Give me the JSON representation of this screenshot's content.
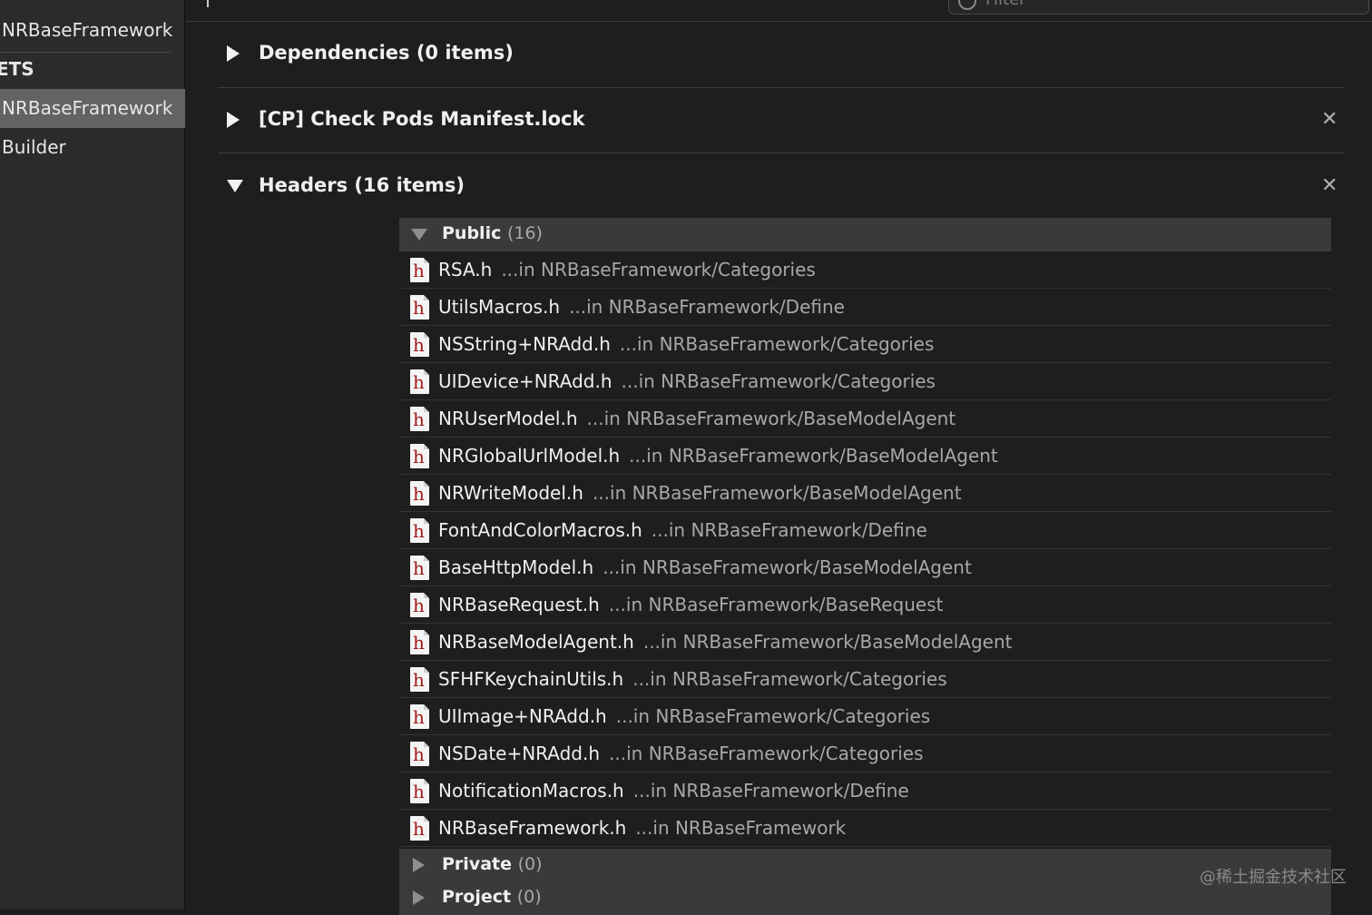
{
  "sidebar": {
    "items": [
      {
        "label": "NRBaseFramework",
        "selected": false
      },
      {
        "label": "ETS",
        "selected": false
      },
      {
        "label": "NRBaseFramework",
        "selected": true
      },
      {
        "label": "Builder",
        "selected": false
      }
    ]
  },
  "filter": {
    "placeholder": "Filter"
  },
  "phases": [
    {
      "title": "Dependencies (0 items)",
      "expanded": false,
      "closable": false
    },
    {
      "title": "[CP] Check Pods Manifest.lock",
      "expanded": false,
      "closable": true,
      "close_glyph": "✕"
    },
    {
      "title": "Headers (16 items)",
      "expanded": true,
      "closable": true,
      "close_glyph": "✕"
    }
  ],
  "headers": {
    "public": {
      "label": "Public",
      "count": "(16)"
    },
    "files": [
      {
        "name": "RSA.h",
        "path": "...in NRBaseFramework/Categories"
      },
      {
        "name": "UtilsMacros.h",
        "path": "...in NRBaseFramework/Define"
      },
      {
        "name": "NSString+NRAdd.h",
        "path": "...in NRBaseFramework/Categories"
      },
      {
        "name": "UIDevice+NRAdd.h",
        "path": "...in NRBaseFramework/Categories"
      },
      {
        "name": "NRUserModel.h",
        "path": "...in NRBaseFramework/BaseModelAgent"
      },
      {
        "name": "NRGlobalUrlModel.h",
        "path": "...in NRBaseFramework/BaseModelAgent"
      },
      {
        "name": "NRWriteModel.h",
        "path": "...in NRBaseFramework/BaseModelAgent"
      },
      {
        "name": "FontAndColorMacros.h",
        "path": "...in NRBaseFramework/Define"
      },
      {
        "name": "BaseHttpModel.h",
        "path": "...in NRBaseFramework/BaseModelAgent"
      },
      {
        "name": "NRBaseRequest.h",
        "path": "...in NRBaseFramework/BaseRequest"
      },
      {
        "name": "NRBaseModelAgent.h",
        "path": "...in NRBaseFramework/BaseModelAgent"
      },
      {
        "name": "SFHFKeychainUtils.h",
        "path": "...in NRBaseFramework/Categories"
      },
      {
        "name": "UIImage+NRAdd.h",
        "path": "...in NRBaseFramework/Categories"
      },
      {
        "name": "NSDate+NRAdd.h",
        "path": "...in NRBaseFramework/Categories"
      },
      {
        "name": "NotificationMacros.h",
        "path": "...in NRBaseFramework/Define"
      },
      {
        "name": "NRBaseFramework.h",
        "path": "...in NRBaseFramework"
      }
    ],
    "private": {
      "label": "Private",
      "count": "(0)"
    },
    "project": {
      "label": "Project",
      "count": "(0)"
    }
  },
  "file_icon_glyph": "h",
  "watermark": "@稀土掘金技术社区"
}
